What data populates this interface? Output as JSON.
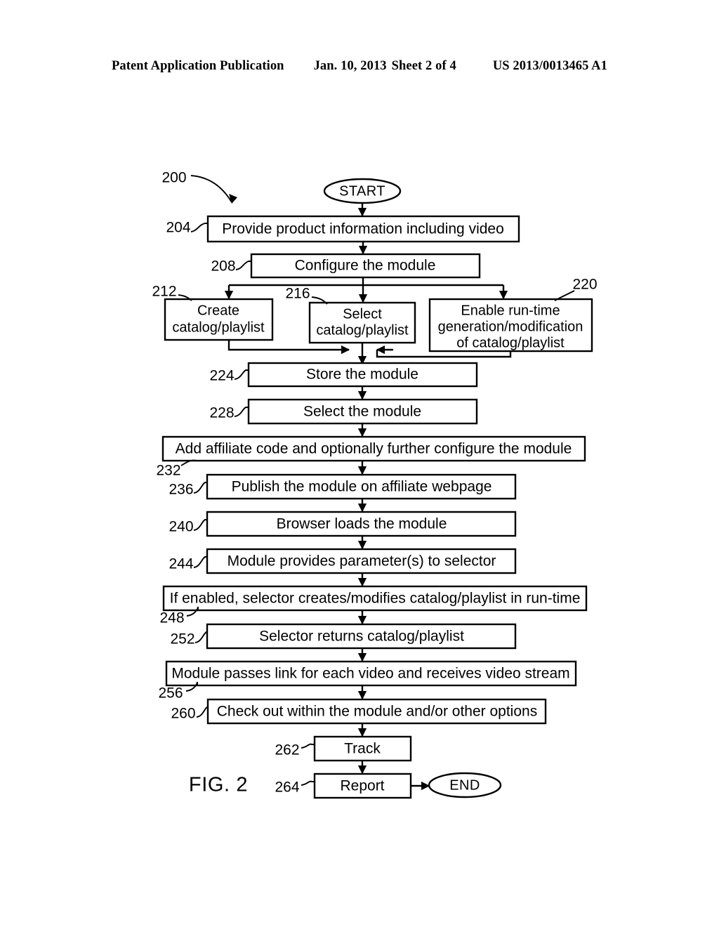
{
  "header": {
    "publication": "Patent Application Publication",
    "date": "Jan. 10, 2013",
    "sheet": "Sheet 2 of 4",
    "doc_number": "US 2013/0013465 A1"
  },
  "figure": {
    "label": "FIG. 2",
    "diagram_ref": "200",
    "terminators": {
      "start": "START",
      "end": "END"
    },
    "steps": [
      {
        "ref": "204",
        "text": "Provide product information including video"
      },
      {
        "ref": "208",
        "text": "Configure the module"
      },
      {
        "ref": "212",
        "line1": "Create",
        "line2": "catalog/playlist"
      },
      {
        "ref": "216",
        "line1": "Select",
        "line2": "catalog/playlist"
      },
      {
        "ref": "220",
        "line1": "Enable run-time",
        "line2": "generation/modification",
        "line3": "of catalog/playlist"
      },
      {
        "ref": "224",
        "text": "Store the module"
      },
      {
        "ref": "228",
        "text": "Select the module"
      },
      {
        "ref": "232",
        "text": "Add affiliate code and optionally further configure the module"
      },
      {
        "ref": "236",
        "text": "Publish the module on affiliate webpage"
      },
      {
        "ref": "240",
        "text": "Browser loads the module"
      },
      {
        "ref": "244",
        "text": "Module provides parameter(s) to selector"
      },
      {
        "ref": "248",
        "text": "If enabled, selector creates/modifies catalog/playlist in run-time"
      },
      {
        "ref": "252",
        "text": "Selector returns catalog/playlist"
      },
      {
        "ref": "256",
        "text": "Module passes link for each video and receives video stream"
      },
      {
        "ref": "260",
        "text": "Check out within the module and/or other options"
      },
      {
        "ref": "262",
        "text": "Track"
      },
      {
        "ref": "264",
        "text": "Report"
      }
    ]
  },
  "colors": {
    "ink": "#000000",
    "paper": "#ffffff"
  }
}
